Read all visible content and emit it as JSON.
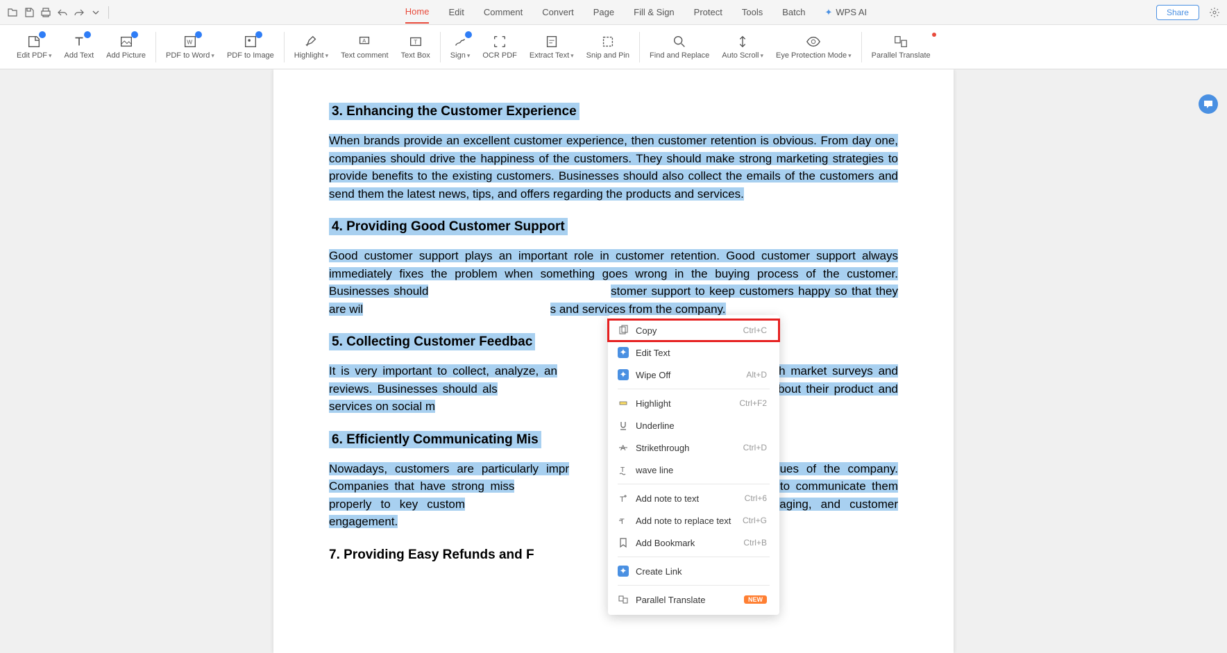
{
  "titleBar": {
    "share": "Share"
  },
  "menu": {
    "home": "Home",
    "edit": "Edit",
    "comment": "Comment",
    "convert": "Convert",
    "page": "Page",
    "fillsign": "Fill & Sign",
    "protect": "Protect",
    "tools": "Tools",
    "batch": "Batch",
    "wpsai": "WPS AI"
  },
  "ribbon": {
    "editpdf": "Edit PDF",
    "addtext": "Add Text",
    "addpicture": "Add Picture",
    "pdftoword": "PDF to Word",
    "pdftoimage": "PDF to Image",
    "highlight": "Highlight",
    "textcomment": "Text comment",
    "textbox": "Text Box",
    "sign": "Sign",
    "ocrpdf": "OCR PDF",
    "extracttext": "Extract Text",
    "snippin": "Snip and Pin",
    "findreplace": "Find and Replace",
    "autoscroll": "Auto Scroll",
    "eyeprotect": "Eye Protection Mode",
    "paralleltranslate": "Parallel Translate"
  },
  "doc": {
    "h3": "3.  Enhancing the Customer Experience",
    "p3": "When brands provide an excellent customer experience, then customer retention is obvious. From day one, companies should drive the happiness of the customers. They should make strong marketing strategies to provide benefits to the existing customers. Businesses should also collect the emails of the customers and send them the latest news, tips, and offers regarding the products and services.",
    "h4": "4.  Providing Good Customer Support",
    "p4a": "Good customer support plays an important role in customer retention. Good customer support always immediately fixes the problem when something goes wrong in the buying process of the customer. Businesses should",
    "p4b": "stomer support to keep customers happy so that they are wil",
    "p4c": "s and services from the company.",
    "h5": "5.  Collecting Customer Feedbac",
    "p5a": "It is very important to collect, analyze, an",
    "p5b": "nrough market surveys and reviews. Businesses should als",
    "p5c": "e conversation about their product and services on social m",
    "h6": "6.  Efficiently Communicating Mis",
    "p6a": "Nowadays, customers are particularly impr",
    "p6b": " values of the company. Companies that have strong miss",
    "p6c": "st effectively to communicate them properly to key custom",
    "p6d": "ct-to-consumer messaging, and customer engagement.",
    "h7": "7.  Providing Easy Refunds and F"
  },
  "ctx": {
    "copy": "Copy",
    "copySc": "Ctrl+C",
    "edittext": "Edit Text",
    "wipeoff": "Wipe Off",
    "wipeoffSc": "Alt+D",
    "highlight": "Highlight",
    "highlightSc": "Ctrl+F2",
    "underline": "Underline",
    "strikethrough": "Strikethrough",
    "strikeSc": "Ctrl+D",
    "waveline": "wave line",
    "addnote": "Add note to text",
    "addnoteSc": "Ctrl+6",
    "addnotereplace": "Add note to replace text",
    "addnotereplaceSc": "Ctrl+G",
    "addbookmark": "Add Bookmark",
    "addbookmarkSc": "Ctrl+B",
    "createlink": "Create Link",
    "paralleltranslate": "Parallel Translate",
    "newbadge": "NEW"
  }
}
